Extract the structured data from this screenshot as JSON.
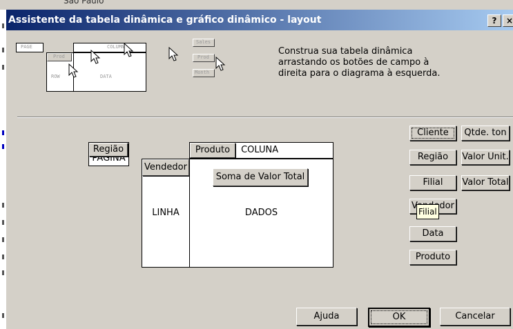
{
  "background": {
    "cell_text": "São Paulo"
  },
  "dialog": {
    "title": "Assistente da tabela dinâmica e gráfico dinâmico - layout",
    "help_label": "?",
    "close_label": "×"
  },
  "preview": {
    "page_label": "PAGE",
    "column_label": "COLUMN",
    "row_label": "ROW",
    "data_label": "DATA",
    "prod_label": "Prod",
    "field_buttons": [
      "Sales",
      "Prod",
      "Month"
    ]
  },
  "instructions": "Construa sua tabela dinâmica arrastando os botões de campo à direita para o diagrama à esquerda.",
  "layout": {
    "page_area": "PÁGINA",
    "column_area": "COLUNA",
    "row_area": "LINHA",
    "data_area": "DADOS",
    "page_field": "Região",
    "column_field": "Produto",
    "row_field": "Vendedor",
    "data_field": "Soma de Valor Total"
  },
  "fields": {
    "col1": [
      "Cliente",
      "Região",
      "Filial",
      "Vendedor",
      "Data",
      "Produto"
    ],
    "col2": [
      "Qtde. ton",
      "Valor Unit.",
      "Valor Total"
    ],
    "tooltip": "Filial"
  },
  "buttons": {
    "help": "Ajuda",
    "ok": "OK",
    "cancel": "Cancelar"
  }
}
